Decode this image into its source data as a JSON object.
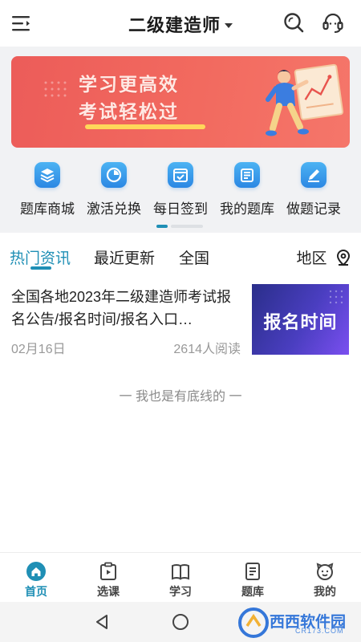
{
  "header": {
    "title": "二级建造师",
    "menu_icon": "menu-icon",
    "search_icon": "search-icon",
    "service_icon": "headset-icon"
  },
  "banner": {
    "line1": "学习更高效",
    "line2": "考试轻松过",
    "color": "#f06560"
  },
  "quick_nav": [
    {
      "label": "题库商城",
      "icon": "layers-icon"
    },
    {
      "label": "激活兑换",
      "icon": "activate-icon"
    },
    {
      "label": "每日签到",
      "icon": "calendar-check-icon"
    },
    {
      "label": "我的题库",
      "icon": "list-icon"
    },
    {
      "label": "做题记录",
      "icon": "edit-icon"
    }
  ],
  "tabs": [
    {
      "label": "热门资讯",
      "active": true
    },
    {
      "label": "最近更新",
      "active": false
    },
    {
      "label": "全国",
      "active": false
    }
  ],
  "region": {
    "label": "地区",
    "icon": "location-pin-icon"
  },
  "news": [
    {
      "title": "全国各地2023年二级建造师考试报名公告/报名时间/报名入口…",
      "date": "02月16日",
      "reads": "2614人阅读",
      "thumb_text": "报名时间"
    }
  ],
  "list_end": "一 我也是有底线的 一",
  "bottom_tabs": [
    {
      "label": "首页",
      "icon": "home-icon",
      "active": true
    },
    {
      "label": "选课",
      "icon": "play-clipboard-icon",
      "active": false
    },
    {
      "label": "学习",
      "icon": "book-icon",
      "active": false
    },
    {
      "label": "题库",
      "icon": "document-icon",
      "active": false
    },
    {
      "label": "我的",
      "icon": "face-icon",
      "active": false
    }
  ],
  "watermark": {
    "text": "西西软件园",
    "sub": "CR173.COM"
  },
  "colors": {
    "accent": "#1f8fb5",
    "icon_blue": "#2b87e3",
    "banner_red": "#f06560"
  }
}
